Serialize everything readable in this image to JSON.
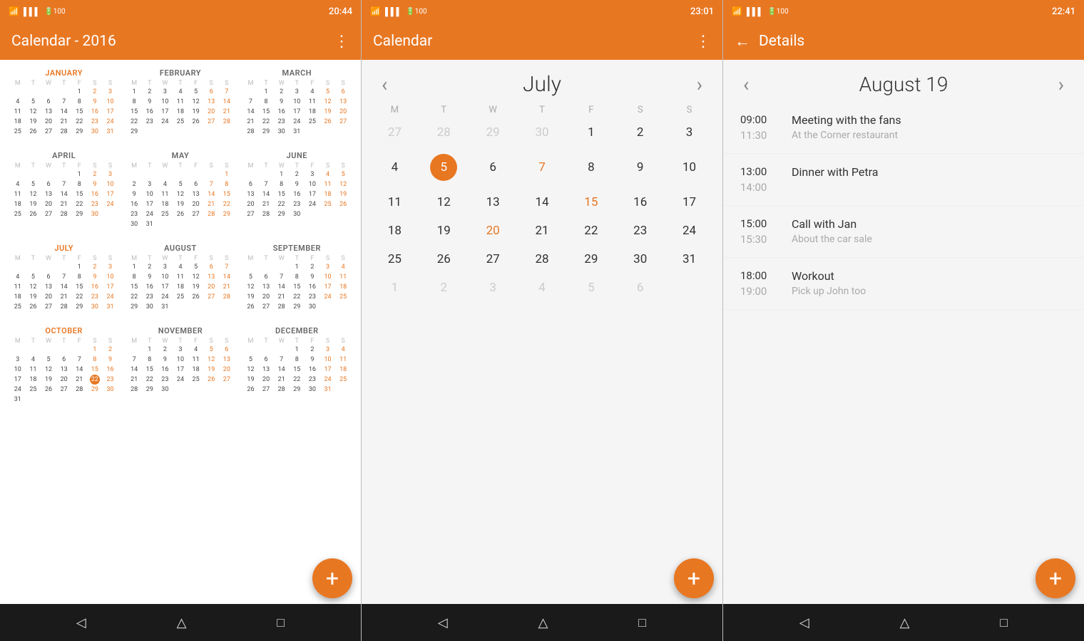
{
  "screens": [
    {
      "id": "screen1",
      "status": {
        "left": "20:44",
        "icons": [
          "wifi",
          "signal",
          "battery"
        ]
      },
      "appBar": {
        "title": "Calendar - 2016",
        "menuIcon": "⋮"
      },
      "year": 2016,
      "months": [
        {
          "name": "JANUARY",
          "days": [
            "",
            "",
            "",
            "1",
            "2",
            "3",
            "4",
            "5",
            "6",
            "7",
            "8",
            "9",
            "10",
            "11",
            "12",
            "13",
            "14",
            "15",
            "16",
            "17",
            "18",
            "19",
            "20",
            "21",
            "22",
            "23",
            "24",
            "25",
            "26",
            "27",
            "28",
            "29",
            "30",
            "31"
          ]
        },
        {
          "name": "FEBRUARY",
          "days": [
            "1",
            "2",
            "3",
            "4",
            "5",
            "6",
            "7",
            "8",
            "9",
            "10",
            "11",
            "12",
            "13",
            "14",
            "15",
            "16",
            "17",
            "18",
            "19",
            "20",
            "21",
            "22",
            "23",
            "24",
            "25",
            "26",
            "27",
            "28",
            "29"
          ]
        },
        {
          "name": "MARCH",
          "days": [
            "",
            "1",
            "2",
            "3",
            "4",
            "5",
            "6",
            "7",
            "8",
            "9",
            "10",
            "11",
            "12",
            "13",
            "14",
            "15",
            "16",
            "17",
            "18",
            "19",
            "20",
            "21",
            "22",
            "23",
            "24",
            "25",
            "26",
            "27",
            "28",
            "29",
            "30",
            "31"
          ]
        },
        {
          "name": "APRIL",
          "days": [
            "",
            "",
            "",
            "",
            "1",
            "2",
            "3",
            "4",
            "5",
            "6",
            "7",
            "8",
            "9",
            "10",
            "11",
            "12",
            "13",
            "14",
            "15",
            "16",
            "17",
            "18",
            "19",
            "20",
            "21",
            "22",
            "23",
            "24",
            "25",
            "26",
            "27",
            "28",
            "29",
            "30"
          ]
        },
        {
          "name": "MAY",
          "days": [
            "",
            "",
            "",
            "",
            "",
            "",
            "1",
            "2",
            "3",
            "4",
            "5",
            "6",
            "7",
            "8",
            "9",
            "10",
            "11",
            "12",
            "13",
            "14",
            "15",
            "16",
            "17",
            "18",
            "19",
            "20",
            "21",
            "22",
            "23",
            "24",
            "25",
            "26",
            "27",
            "28",
            "29",
            "30",
            "31"
          ]
        },
        {
          "name": "JUNE",
          "days": [
            "",
            "",
            "1",
            "2",
            "3",
            "4",
            "5",
            "6",
            "7",
            "8",
            "9",
            "10",
            "11",
            "12",
            "13",
            "14",
            "15",
            "16",
            "17",
            "18",
            "19",
            "20",
            "21",
            "22",
            "23",
            "24",
            "25",
            "26",
            "27",
            "28",
            "29",
            "30"
          ]
        },
        {
          "name": "JULY",
          "days": [
            "",
            "",
            "",
            "",
            "1",
            "2",
            "3",
            "4",
            "5",
            "6",
            "7",
            "8",
            "9",
            "10",
            "11",
            "12",
            "13",
            "14",
            "15",
            "16",
            "17",
            "18",
            "19",
            "20",
            "21",
            "22",
            "23",
            "24",
            "25",
            "26",
            "27",
            "28",
            "29",
            "30",
            "31"
          ]
        },
        {
          "name": "AUGUST",
          "days": [
            "1",
            "2",
            "3",
            "4",
            "5",
            "6",
            "7",
            "8",
            "9",
            "10",
            "11",
            "12",
            "13",
            "14",
            "15",
            "16",
            "17",
            "18",
            "19",
            "20",
            "21",
            "22",
            "23",
            "24",
            "25",
            "26",
            "27",
            "28",
            "29",
            "30",
            "31"
          ]
        },
        {
          "name": "SEPTEMBER",
          "days": [
            "",
            "",
            "",
            "1",
            "2",
            "3",
            "4",
            "5",
            "6",
            "7",
            "8",
            "9",
            "10",
            "11",
            "12",
            "13",
            "14",
            "15",
            "16",
            "17",
            "18",
            "19",
            "20",
            "21",
            "22",
            "23",
            "24",
            "25",
            "26",
            "27",
            "28",
            "29",
            "30"
          ]
        },
        {
          "name": "OCTOBER",
          "days": [
            "",
            "",
            "",
            "",
            "",
            "",
            "1",
            "2",
            "3",
            "4",
            "5",
            "6",
            "7",
            "8",
            "9",
            "10",
            "11",
            "12",
            "13",
            "14",
            "15",
            "16",
            "17",
            "18",
            "19",
            "20",
            "21",
            "22",
            "23",
            "24",
            "25",
            "26",
            "27",
            "28",
            "29",
            "30",
            "31"
          ]
        },
        {
          "name": "NOVEMBER",
          "days": [
            "",
            "1",
            "2",
            "3",
            "4",
            "5",
            "6",
            "7",
            "8",
            "9",
            "10",
            "11",
            "12",
            "13",
            "14",
            "15",
            "16",
            "17",
            "18",
            "19",
            "20",
            "21",
            "22",
            "23",
            "24",
            "25",
            "26",
            "27",
            "28",
            "29",
            "30"
          ]
        },
        {
          "name": "DECEMBER",
          "days": [
            "",
            "",
            "",
            "1",
            "2",
            "3",
            "4",
            "5",
            "6",
            "7",
            "8",
            "9",
            "10",
            "11",
            "12",
            "13",
            "14",
            "15",
            "16",
            "17",
            "18",
            "19",
            "20",
            "21",
            "22",
            "23",
            "24",
            "25",
            "26",
            "27",
            "28",
            "29",
            "30",
            "31"
          ]
        }
      ],
      "fab": "+",
      "bottomNav": [
        "◁",
        "△",
        "□"
      ]
    },
    {
      "id": "screen2",
      "status": {
        "left": "23:01",
        "icons": [
          "wifi",
          "signal",
          "battery"
        ]
      },
      "appBar": {
        "title": "Calendar",
        "menuIcon": "⋮"
      },
      "monthView": {
        "title": "July",
        "prevArrow": "‹",
        "nextArrow": "›",
        "dayHeaders": [
          "M",
          "T",
          "W",
          "T",
          "F",
          "S",
          "S"
        ],
        "weeks": [
          [
            {
              "day": "27",
              "faded": true
            },
            {
              "day": "28",
              "faded": true
            },
            {
              "day": "29",
              "faded": true
            },
            {
              "day": "30",
              "faded": true
            },
            {
              "day": "1",
              "accent": false
            },
            {
              "day": "2",
              "accent": false
            },
            {
              "day": "3",
              "accent": false
            }
          ],
          [
            {
              "day": "4",
              "accent": false
            },
            {
              "day": "5",
              "today": true,
              "accent": true
            },
            {
              "day": "6",
              "accent": false
            },
            {
              "day": "7",
              "accent": true
            },
            {
              "day": "8",
              "accent": false
            },
            {
              "day": "9",
              "accent": false
            },
            {
              "day": "10",
              "accent": false
            }
          ],
          [
            {
              "day": "11",
              "accent": false
            },
            {
              "day": "12",
              "accent": false
            },
            {
              "day": "13",
              "accent": false
            },
            {
              "day": "14",
              "accent": false
            },
            {
              "day": "15",
              "accent": true
            },
            {
              "day": "16",
              "accent": false
            },
            {
              "day": "17",
              "accent": false
            }
          ],
          [
            {
              "day": "18",
              "accent": false
            },
            {
              "day": "19",
              "accent": false
            },
            {
              "day": "20",
              "accent": true
            },
            {
              "day": "21",
              "accent": false
            },
            {
              "day": "22",
              "accent": false
            },
            {
              "day": "23",
              "accent": false
            },
            {
              "day": "24",
              "accent": false
            }
          ],
          [
            {
              "day": "25",
              "accent": false
            },
            {
              "day": "26",
              "accent": false
            },
            {
              "day": "27",
              "accent": false
            },
            {
              "day": "28",
              "accent": false
            },
            {
              "day": "29",
              "accent": false
            },
            {
              "day": "30",
              "accent": false
            },
            {
              "day": "31",
              "accent": false
            }
          ],
          [
            {
              "day": "1",
              "faded": true
            },
            {
              "day": "2",
              "faded": true
            },
            {
              "day": "3",
              "faded": true
            },
            {
              "day": "4",
              "faded": true
            },
            {
              "day": "5",
              "faded": true
            },
            {
              "day": "6",
              "faded": true
            },
            {
              "day": "",
              "faded": true
            }
          ]
        ]
      },
      "fab": "+",
      "bottomNav": [
        "◁",
        "△",
        "□"
      ]
    },
    {
      "id": "screen3",
      "status": {
        "left": "22:41",
        "icons": [
          "wifi",
          "signal",
          "battery"
        ]
      },
      "appBar": {
        "backIcon": "←",
        "title": "Details"
      },
      "detailsNav": {
        "prevArrow": "‹",
        "title": "August 19",
        "nextArrow": "›"
      },
      "events": [
        {
          "startTime": "09:00",
          "endTime": "11:30",
          "title": "Meeting with the fans",
          "subtitle": "At the Corner restaurant"
        },
        {
          "startTime": "13:00",
          "endTime": "14:00",
          "title": "Dinner with Petra",
          "subtitle": ""
        },
        {
          "startTime": "15:00",
          "endTime": "15:30",
          "title": "Call with Jan",
          "subtitle": "About the car sale"
        },
        {
          "startTime": "18:00",
          "endTime": "19:00",
          "title": "Workout",
          "subtitle": "Pick up John too"
        }
      ],
      "fab": "+",
      "bottomNav": [
        "◁",
        "△",
        "□"
      ]
    }
  ]
}
